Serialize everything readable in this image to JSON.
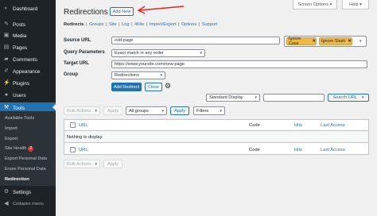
{
  "sidebar": {
    "items": [
      {
        "label": "Dashboard",
        "icon": "dashboard-icon",
        "glyph": "◐"
      },
      {
        "label": "Posts",
        "icon": "pin-icon",
        "glyph": "✎"
      },
      {
        "label": "Media",
        "icon": "media-icon",
        "glyph": "▣"
      },
      {
        "label": "Pages",
        "icon": "page-icon",
        "glyph": "▤"
      },
      {
        "label": "Comments",
        "icon": "comment-icon",
        "glyph": "▰"
      },
      {
        "label": "Appearance",
        "icon": "brush-icon",
        "glyph": "✐"
      },
      {
        "label": "Plugins",
        "icon": "plugin-icon",
        "glyph": "⚡"
      },
      {
        "label": "Users",
        "icon": "user-icon",
        "glyph": "●"
      },
      {
        "label": "Tools",
        "icon": "wrench-icon",
        "glyph": "⚒"
      }
    ],
    "tools_submenu": [
      {
        "label": "Available Tools"
      },
      {
        "label": "Import"
      },
      {
        "label": "Export"
      },
      {
        "label": "Site Health",
        "badge": "2"
      },
      {
        "label": "Export Personal Data"
      },
      {
        "label": "Erase Personal Data"
      },
      {
        "label": "Redirection"
      }
    ],
    "settings": {
      "label": "Settings",
      "glyph": "⚙"
    },
    "collapse": {
      "label": "Collapse menu",
      "glyph": "◀"
    }
  },
  "topbar": {
    "screen_options": "Screen Options ▾",
    "help": "Help ▾"
  },
  "page": {
    "title": "Redirections",
    "add_new": "Add New"
  },
  "subnav": [
    {
      "label": "Redirects",
      "current": true
    },
    {
      "label": "Groups"
    },
    {
      "label": "Site"
    },
    {
      "label": "Log"
    },
    {
      "label": "404s"
    },
    {
      "label": "Import/Export"
    },
    {
      "label": "Options"
    },
    {
      "label": "Support"
    }
  ],
  "form": {
    "source_label": "Source URL",
    "source_value": "/old-page",
    "query_label": "Query Parameters",
    "query_value": "Exact match in any order",
    "target_label": "Target URL",
    "target_value": "https://www.yoursite.com/new-page",
    "group_label": "Group",
    "group_value": "Redirections",
    "tags": [
      {
        "label": "Ignore Case"
      },
      {
        "label": "Ignore Slash"
      }
    ],
    "add_button": "Add Redirect",
    "close_button": "Close"
  },
  "toolbar_top": {
    "display": "Standard Display",
    "search_placeholder": "",
    "search_select": "Search URL",
    "bulk": "Bulk Actions",
    "apply": "Apply",
    "groups": "All groups",
    "apply2": "Apply",
    "filters": "Filters"
  },
  "table": {
    "columns": {
      "url": "URL",
      "code": "Code",
      "hits": "Hits",
      "last_access": "Last Access"
    },
    "empty_message": "Nothing to display."
  },
  "toolbar_bottom": {
    "bulk": "Bulk Actions",
    "apply": "Apply"
  },
  "colors": {
    "sidebar_bg": "#1d2327",
    "accent": "#2271b1",
    "tag": "#f0b849",
    "annotation_arrow": "#e32521"
  }
}
